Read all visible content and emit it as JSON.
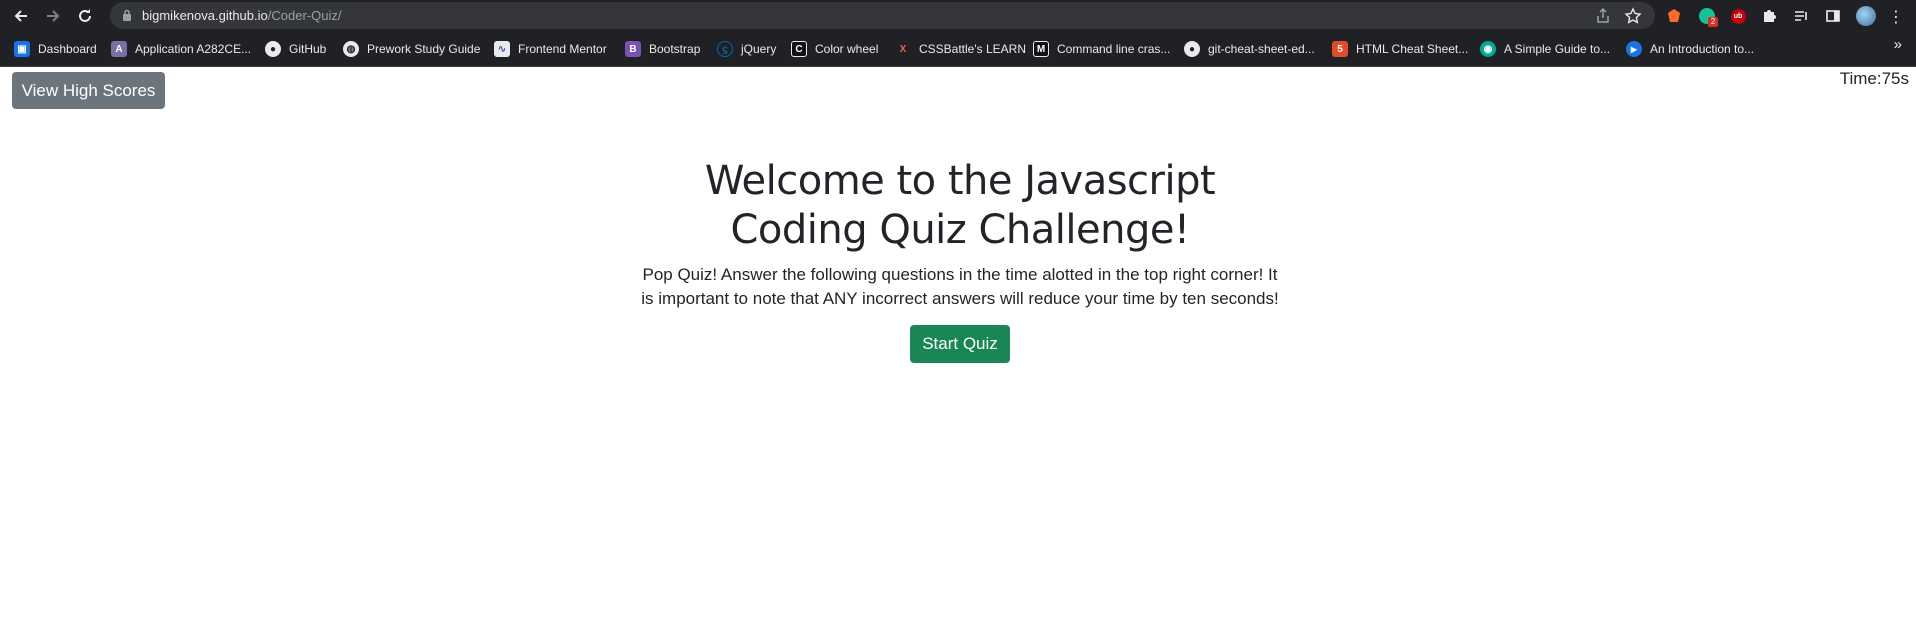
{
  "browser": {
    "url_host": "bigmikenova.github.io",
    "url_path": "/Coder-Quiz/",
    "extensions": [
      {
        "name": "brave-icon",
        "color": "#ff6a2a"
      },
      {
        "name": "grammarly-icon",
        "color": "#15c39a",
        "badge": "2"
      },
      {
        "name": "ublock-icon",
        "color": "#c4000c",
        "text": "ub"
      },
      {
        "name": "puzzle-icon",
        "color": "#e8eaed"
      },
      {
        "name": "reading-list-icon",
        "color": "#e8eaed"
      },
      {
        "name": "side-panel-icon",
        "color": "#e8eaed"
      },
      {
        "name": "profile-avatar",
        "color": "#4a90c2"
      }
    ],
    "bookmarks": [
      {
        "label": "Dashboard",
        "icon": "dashboard-icon",
        "color": "#1a73e8",
        "glyph": "▣"
      },
      {
        "label": "Application A282CE...",
        "icon": "application-icon",
        "color": "#7b6fa8",
        "glyph": "A"
      },
      {
        "label": "GitHub",
        "icon": "github-icon",
        "color": "#24292e",
        "glyph": "●"
      },
      {
        "label": "Prework Study Guide",
        "icon": "globe-icon",
        "color": "#5f6368",
        "glyph": "◍"
      },
      {
        "label": "Frontend Mentor",
        "icon": "frontend-mentor-icon",
        "color": "#e8eaed",
        "glyph": "∿"
      },
      {
        "label": "Bootstrap",
        "icon": "bootstrap-icon",
        "color": "#7952b3",
        "glyph": "B"
      },
      {
        "label": "jQuery",
        "icon": "jquery-icon",
        "color": "#0769ad",
        "glyph": "ϛ"
      },
      {
        "label": "Color wheel",
        "icon": "color-wheel-icon",
        "color": "#111111",
        "glyph": "C"
      },
      {
        "label": "CSSBattle's LEARN",
        "icon": "cssbattle-icon",
        "color": "#202124",
        "glyph": "X"
      },
      {
        "label": "Command line cras...",
        "icon": "command-line-icon",
        "color": "#111111",
        "glyph": "M"
      },
      {
        "label": "git-cheat-sheet-ed...",
        "icon": "github-icon",
        "color": "#24292e",
        "glyph": "●"
      },
      {
        "label": "HTML Cheat Sheet...",
        "icon": "html5-icon",
        "color": "#e34c26",
        "glyph": "5"
      },
      {
        "label": "A Simple Guide to...",
        "icon": "simple-guide-icon",
        "color": "#00a99d",
        "glyph": "◉"
      },
      {
        "label": "An Introduction to...",
        "icon": "play-icon",
        "color": "#1a73e8",
        "glyph": "▶"
      }
    ],
    "more_label": "»"
  },
  "page": {
    "high_scores_label": "View High Scores",
    "timer_label": "Time:",
    "timer_value": "75s",
    "title": "Welcome to the Javascript Coding Quiz Challenge!",
    "description": "Pop Quiz! Answer the following questions in the time alotted in the top right corner! It is important to note that ANY incorrect answers will reduce your time by ten seconds!",
    "start_label": "Start Quiz"
  },
  "colors": {
    "chrome_bg": "#202124",
    "omnibox_bg": "#35363a",
    "secondary_button": "#6c757d",
    "success_button": "#198754",
    "text": "#212529"
  }
}
